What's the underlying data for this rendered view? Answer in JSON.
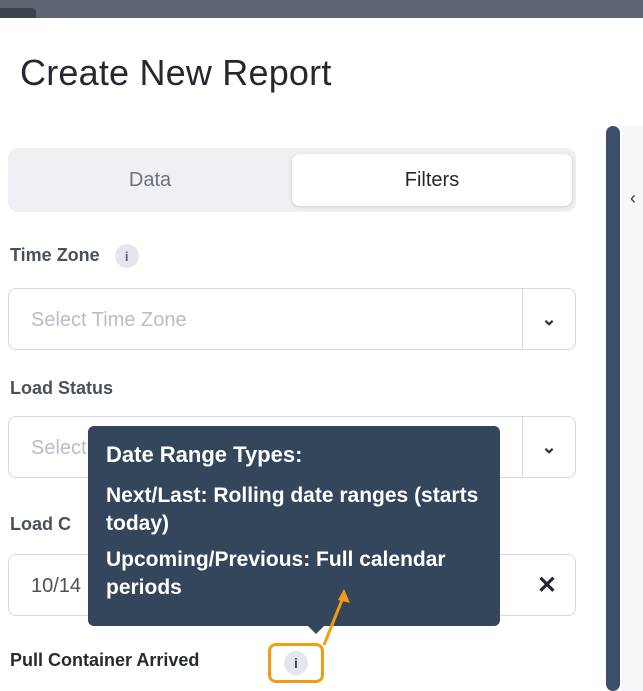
{
  "dialog": {
    "title": "Create New Report"
  },
  "tabs": [
    {
      "label": "Data",
      "active": false
    },
    {
      "label": "Filters",
      "active": true
    }
  ],
  "filters": {
    "time_zone": {
      "label": "Time Zone",
      "placeholder": "Select Time Zone"
    },
    "load_status": {
      "label": "Load Status",
      "placeholder": "Select"
    },
    "load_date": {
      "label": "Load C",
      "value": "10/14"
    },
    "pull_container": {
      "label": "Pull Container Arrived"
    }
  },
  "tooltip": {
    "title": "Date Range Types:",
    "lines": [
      {
        "key": "Next/Last:",
        "text": " Rolling date ranges (starts today)"
      },
      {
        "key": "Upcoming/Previous:",
        "text": " Full calendar periods"
      }
    ]
  },
  "icons": {
    "info": "i",
    "caret": "⌄",
    "clear": "✕",
    "panel_chevron": "‹"
  },
  "colors": {
    "tooltip_bg": "#34465c",
    "highlight": "#f39c12",
    "divider": "#3b4f6b"
  }
}
